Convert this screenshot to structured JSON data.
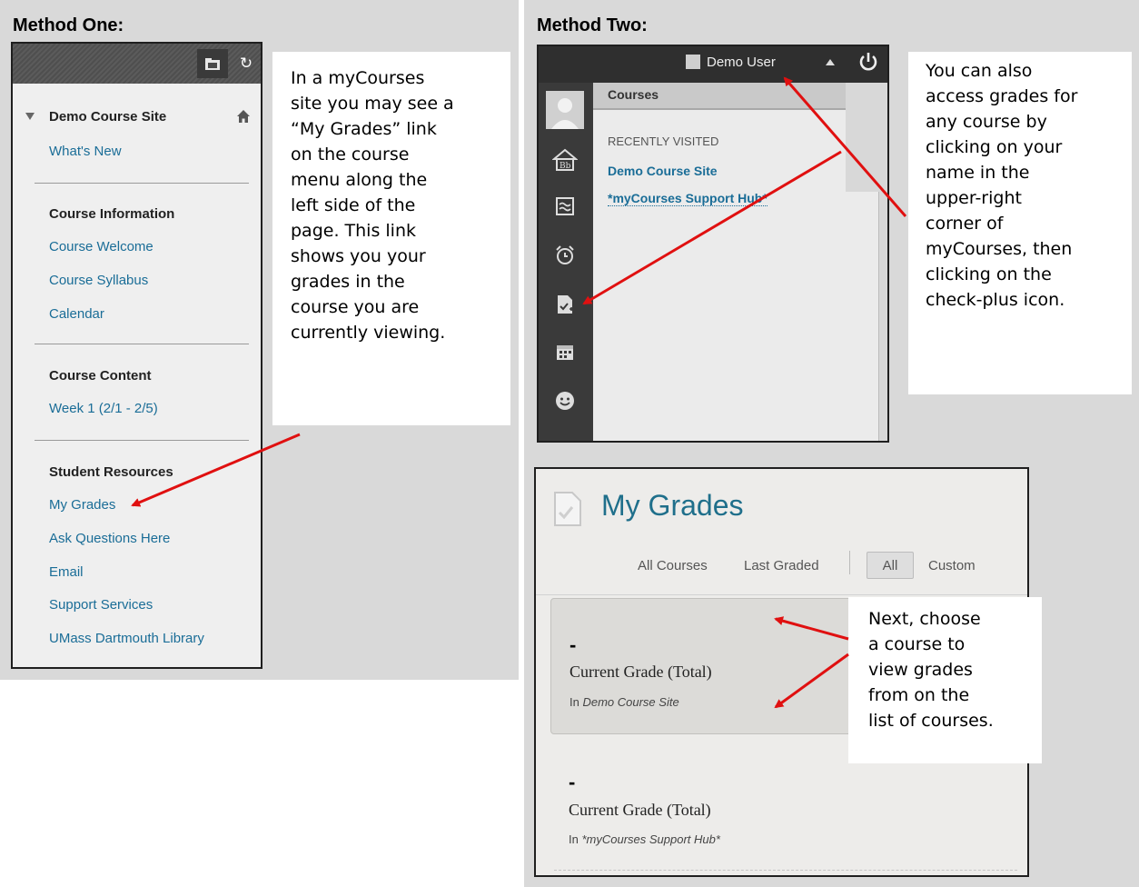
{
  "method_one": {
    "title": "Method One:",
    "callout": [
      "In a myCourses",
      "site you may see a",
      "“My Grades” link",
      "on the course",
      "menu along the",
      "left side of the",
      "page. This link",
      "shows you your",
      "grades in the",
      "course you are",
      "currently viewing."
    ],
    "menu": {
      "course_name": "Demo Course Site",
      "whats_new": "What's New",
      "sections": [
        {
          "heading": "Course Information",
          "items": [
            "Course Welcome",
            "Course Syllabus",
            "Calendar"
          ]
        },
        {
          "heading": "Course Content",
          "items": [
            "Week 1 (2/1 - 2/5)"
          ]
        },
        {
          "heading": "Student Resources",
          "items": [
            "My Grades",
            "Ask Questions Here",
            "Email",
            "Support Services",
            "UMass Dartmouth Library"
          ]
        }
      ]
    }
  },
  "method_two": {
    "title": "Method Two:",
    "callout": [
      "You can also",
      "access grades for",
      "any course by",
      "clicking on your",
      "name in the",
      "upper-right",
      "corner of",
      "myCourses, then",
      "clicking on the",
      "check-plus icon."
    ],
    "global_nav": {
      "user_name": "Demo User",
      "dropdown_header": "Courses",
      "recent_label": "RECENTLY VISITED",
      "recent_courses": [
        "Demo Course Site",
        "*myCourses Support Hub*"
      ],
      "icons": [
        "profile-avatar-icon",
        "blackboard-home-icon",
        "activity-stream-icon",
        "alarm-clock-icon",
        "check-plus-grades-icon",
        "calendar-icon",
        "smiley-icon"
      ]
    },
    "grades": {
      "title": "My Grades",
      "filters": [
        "All Courses",
        "Last Graded",
        "All",
        "Custom"
      ],
      "selected_filter": "All",
      "cards": [
        {
          "score": "-",
          "label": "Current Grade (Total)",
          "in_prefix": "In ",
          "course": "Demo Course Site"
        },
        {
          "score": "-",
          "label": "Current Grade (Total)",
          "in_prefix": "In ",
          "course": "*myCourses Support Hub*"
        }
      ]
    },
    "next_callout": [
      "Next, choose",
      "a course to",
      "view grades",
      "from on the",
      "list of courses."
    ]
  },
  "colors": {
    "panel_bg": "#d9d9d9",
    "link_blue": "#1a6d97",
    "arrow_red": "#e01010",
    "title_teal": "#1f6f8b"
  }
}
